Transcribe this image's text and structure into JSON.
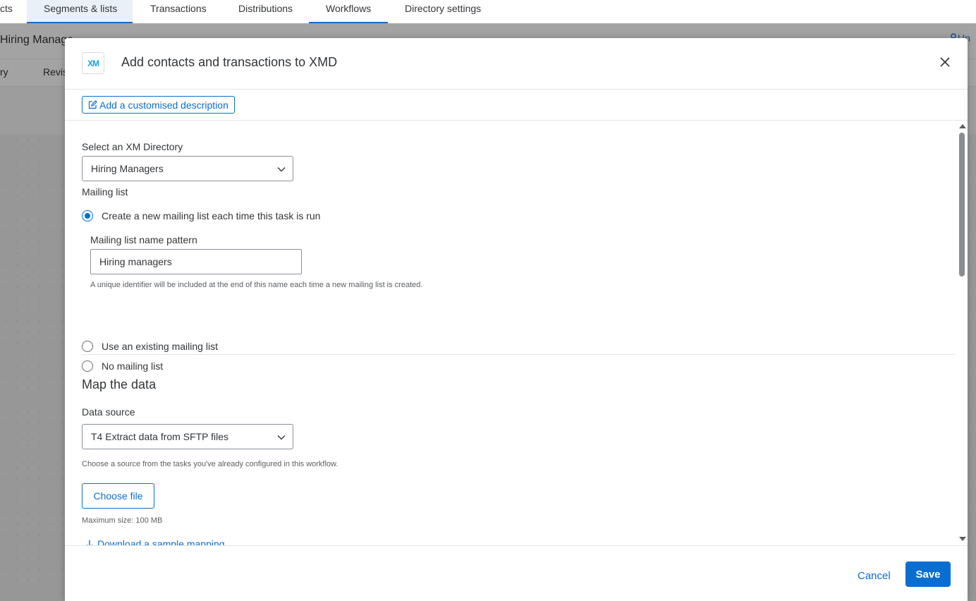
{
  "colors": {
    "accent": "#0a6ed1",
    "overlay": "#9a9a9a",
    "logo": "#14a5e6"
  },
  "top_nav": {
    "tabs": [
      {
        "label": "cts"
      },
      {
        "label": "Segments & lists",
        "active": true
      },
      {
        "label": "Transactions"
      },
      {
        "label": "Distributions"
      },
      {
        "label": "Workflows"
      },
      {
        "label": "Directory settings"
      }
    ]
  },
  "background": {
    "page_title": "Hiring Manage",
    "subtabs": [
      "ry",
      "Revis"
    ],
    "user_label": "Un"
  },
  "modal": {
    "logo_text": "XM",
    "logo_icon": "xm-logo-icon",
    "title": "Add contacts and transactions to XMD",
    "close_icon": "close-icon",
    "description_button": "Add a customised description",
    "description_icon": "edit-icon",
    "directory": {
      "label": "Select an XM Directory",
      "value": "Hiring Managers"
    },
    "mailing_list": {
      "label": "Mailing list",
      "options": [
        {
          "label": "Create a new mailing list each time this task is run",
          "checked": true
        },
        {
          "label": "Use an existing mailing list",
          "checked": false
        },
        {
          "label": "No mailing list",
          "checked": false
        }
      ],
      "name_pattern_label": "Mailing list name pattern",
      "name_pattern_value": "Hiring managers",
      "name_pattern_hint": "A unique identifier will be included at the end of this name each time a new mailing list is created."
    },
    "map_data": {
      "title": "Map the data",
      "source_label": "Data source",
      "source_value": "T4 Extract data from SFTP files",
      "source_hint": "Choose a source from the tasks you've already configured in this workflow.",
      "choose_file": "Choose file",
      "max_size": "Maximum size: 100 MB",
      "download_link": "Download a sample mapping"
    },
    "footer": {
      "cancel": "Cancel",
      "save": "Save"
    }
  }
}
